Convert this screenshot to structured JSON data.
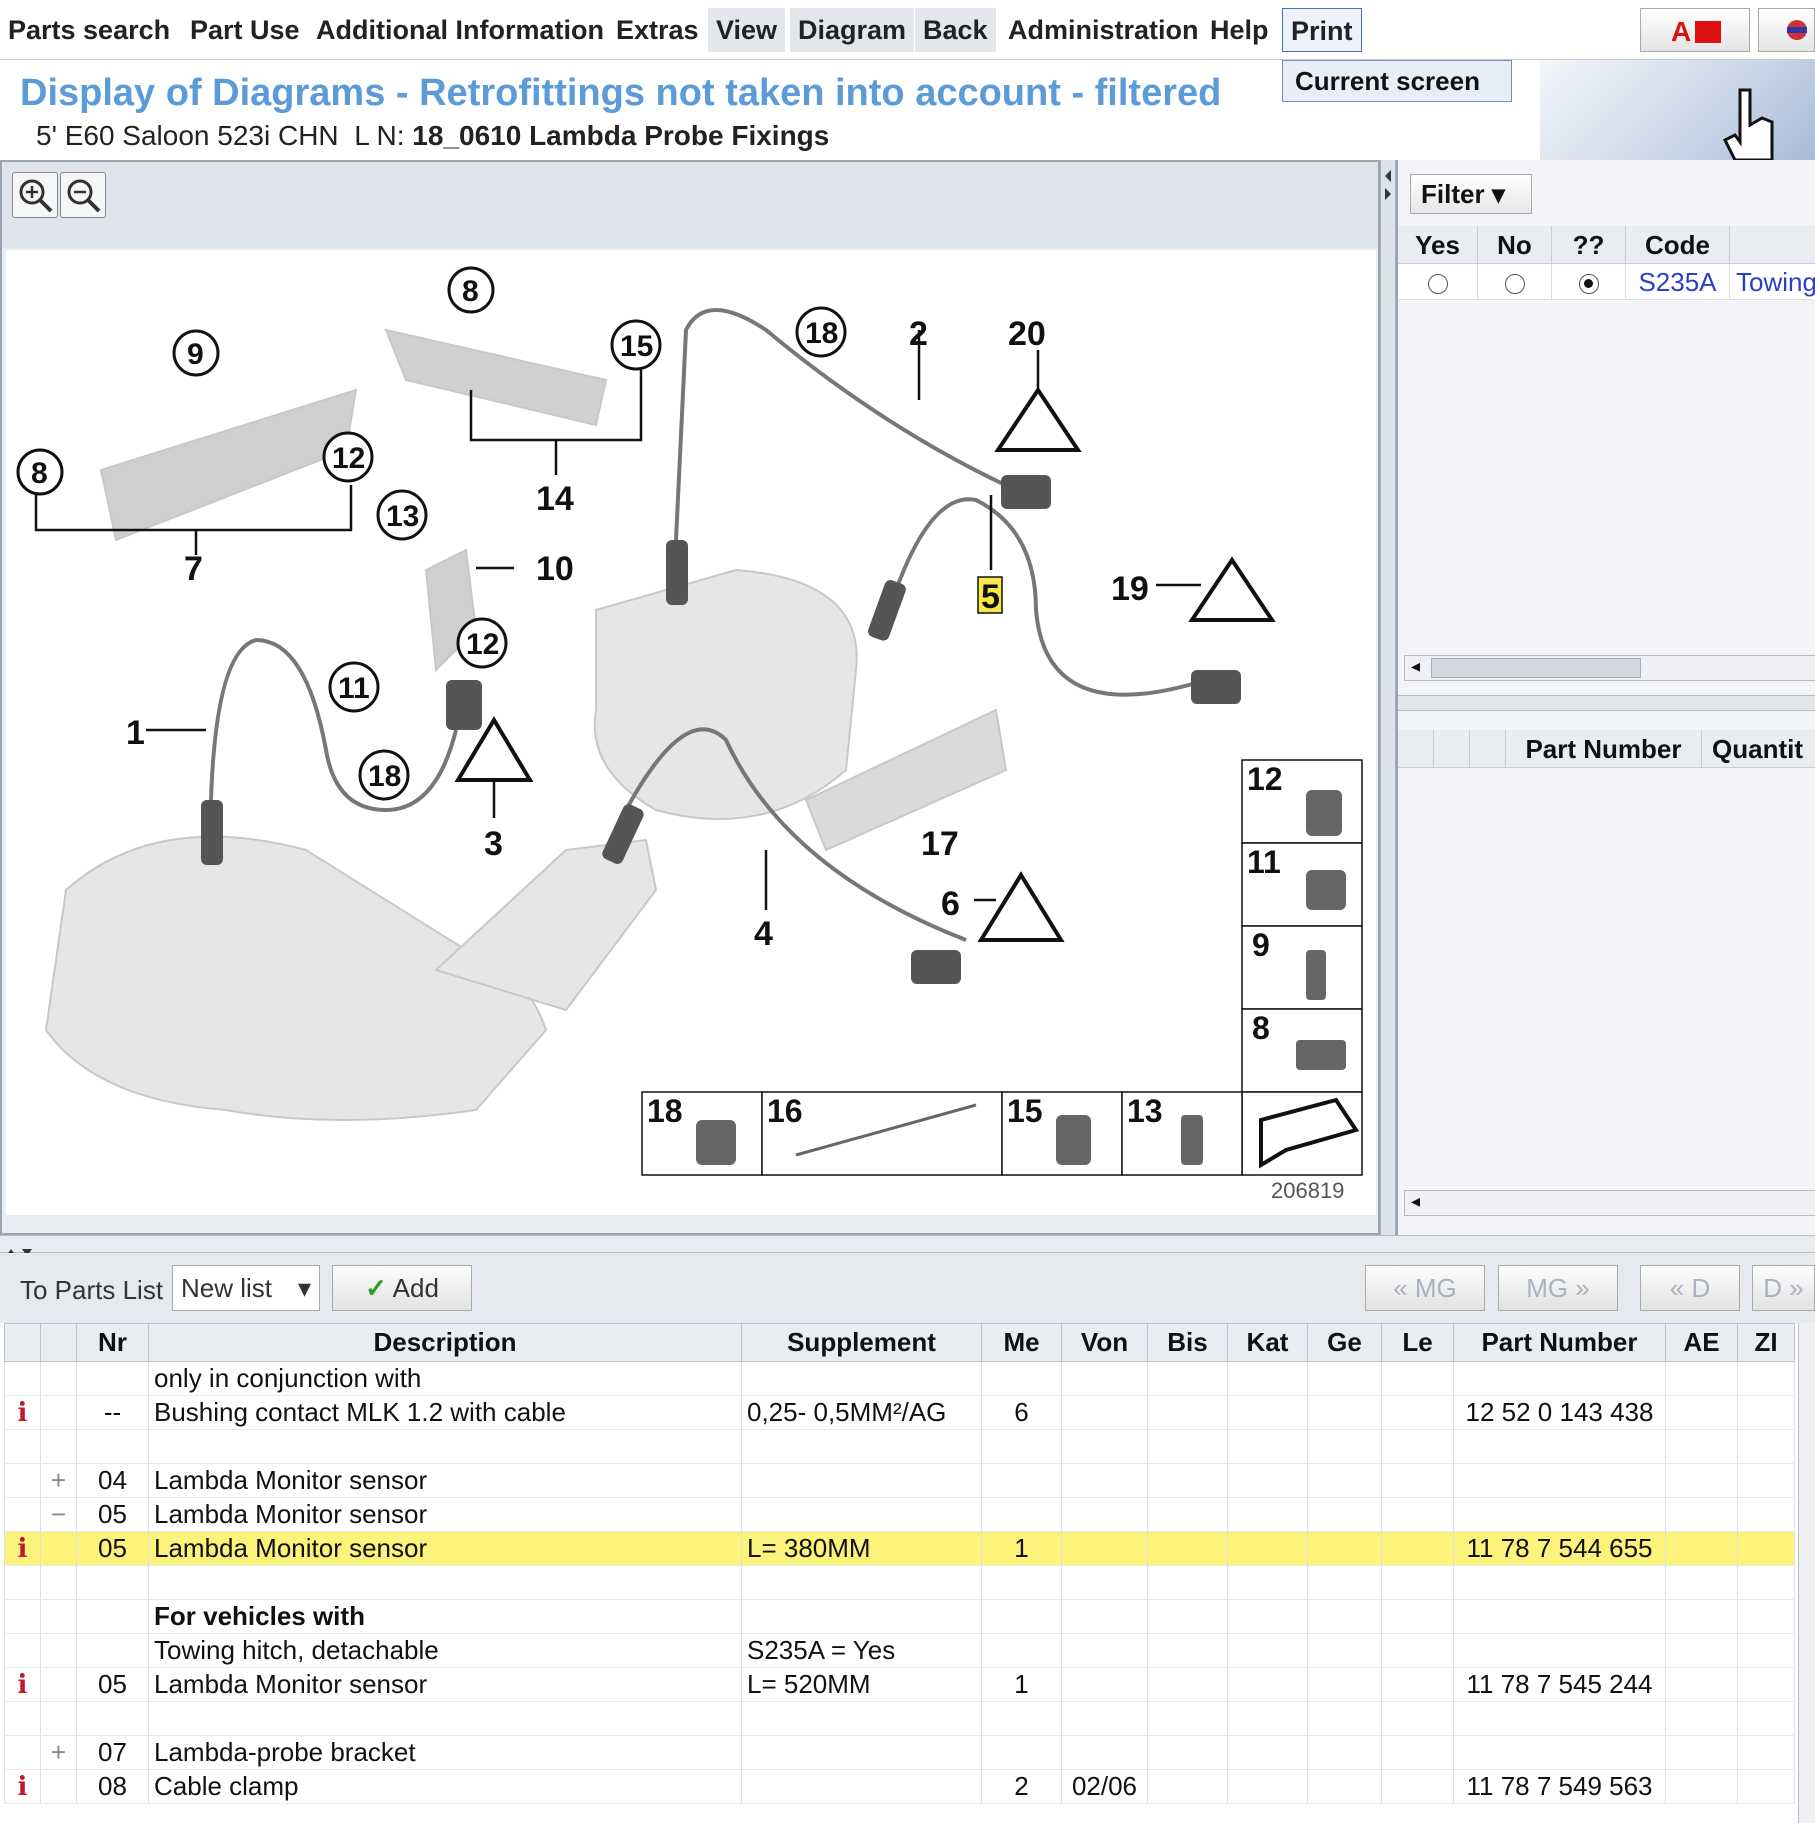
{
  "menu": {
    "items": [
      {
        "label": "Parts search"
      },
      {
        "label": "Part Use"
      },
      {
        "label": "Additional Information"
      },
      {
        "label": "Extras"
      },
      {
        "label": "View"
      },
      {
        "label": "Diagram"
      },
      {
        "label": "Back"
      },
      {
        "label": "Administration"
      },
      {
        "label": "Help"
      },
      {
        "label": "Print"
      }
    ],
    "print_dropdown": "Current screen"
  },
  "header": {
    "title": "Display of Diagrams - Retrofittings not taken into account - filtered",
    "vehicle": "5' E60 Saloon 523i CHN",
    "ln_prefix": "L N:",
    "ln_code": "18_0610 Lambda Probe Fixings"
  },
  "diagram": {
    "image_number": "206819",
    "highlighted_callout": "5",
    "callouts": [
      "1",
      "2",
      "3",
      "4",
      "5",
      "6",
      "7",
      "8",
      "8",
      "9",
      "10",
      "11",
      "12",
      "13",
      "14",
      "15",
      "17",
      "18",
      "18",
      "19",
      "20"
    ],
    "legend": [
      "12",
      "11",
      "9",
      "8",
      "18",
      "16",
      "15",
      "13"
    ]
  },
  "filter": {
    "button_label": "Filter",
    "columns": [
      "Yes",
      "No",
      "??",
      "Code"
    ],
    "rows": [
      {
        "yes": false,
        "no": false,
        "unknown": true,
        "code": "S235A",
        "desc": "Towing"
      }
    ],
    "lower_columns": [
      "Part Number",
      "Quantit"
    ]
  },
  "parts_toolbar": {
    "to_parts_list": "To Parts List",
    "list_select": "New list",
    "add_label": "Add",
    "nav": [
      "« MG",
      "MG »",
      "« D",
      "D »"
    ]
  },
  "parts_table": {
    "columns": [
      "",
      "",
      "Nr",
      "Description",
      "Supplement",
      "Me",
      "Von",
      "Bis",
      "Kat",
      "Ge",
      "Le",
      "Part Number",
      "AE",
      "ZI"
    ],
    "rows": [
      {
        "info": "",
        "exp": "",
        "nr": "",
        "desc": "only in conjunction with",
        "supp": "",
        "me": "",
        "von": "",
        "part": "",
        "bold": false,
        "hl": false
      },
      {
        "info": "i",
        "exp": "",
        "nr": "--",
        "desc": "Bushing contact MLK 1.2 with cable",
        "supp": "0,25- 0,5MM²/AG",
        "me": "6",
        "von": "",
        "part": "12 52 0 143 438",
        "bold": false,
        "hl": false
      },
      {
        "info": "",
        "exp": "",
        "nr": "",
        "desc": "",
        "supp": "",
        "me": "",
        "von": "",
        "part": "",
        "bold": false,
        "hl": false
      },
      {
        "info": "",
        "exp": "+",
        "nr": "04",
        "desc": "Lambda Monitor sensor",
        "supp": "",
        "me": "",
        "von": "",
        "part": "",
        "bold": false,
        "hl": false
      },
      {
        "info": "",
        "exp": "−",
        "nr": "05",
        "desc": "Lambda Monitor sensor",
        "supp": "",
        "me": "",
        "von": "",
        "part": "",
        "bold": false,
        "hl": false
      },
      {
        "info": "i",
        "exp": "",
        "nr": "05",
        "desc": "Lambda Monitor sensor",
        "supp": "L= 380MM",
        "me": "1",
        "von": "",
        "part": "11 78 7 544 655",
        "bold": false,
        "hl": true
      },
      {
        "info": "",
        "exp": "",
        "nr": "",
        "desc": "",
        "supp": "",
        "me": "",
        "von": "",
        "part": "",
        "bold": false,
        "hl": false
      },
      {
        "info": "",
        "exp": "",
        "nr": "",
        "desc": "For vehicles with",
        "supp": "",
        "me": "",
        "von": "",
        "part": "",
        "bold": true,
        "hl": false
      },
      {
        "info": "",
        "exp": "",
        "nr": "",
        "desc": "Towing hitch, detachable",
        "supp": "S235A = Yes",
        "me": "",
        "von": "",
        "part": "",
        "bold": false,
        "hl": false
      },
      {
        "info": "i",
        "exp": "",
        "nr": "05",
        "desc": "Lambda Monitor sensor",
        "supp": "L= 520MM",
        "me": "1",
        "von": "",
        "part": "11 78 7 545 244",
        "bold": false,
        "hl": false
      },
      {
        "info": "",
        "exp": "",
        "nr": "",
        "desc": "",
        "supp": "",
        "me": "",
        "von": "",
        "part": "",
        "bold": false,
        "hl": false
      },
      {
        "info": "",
        "exp": "+",
        "nr": "07",
        "desc": "Lambda-probe bracket",
        "supp": "",
        "me": "",
        "von": "",
        "part": "",
        "bold": false,
        "hl": false
      },
      {
        "info": "i",
        "exp": "",
        "nr": "08",
        "desc": "Cable clamp",
        "supp": "",
        "me": "2",
        "von": "02/06",
        "part": "11 78 7 549 563",
        "bold": false,
        "hl": false
      }
    ]
  }
}
